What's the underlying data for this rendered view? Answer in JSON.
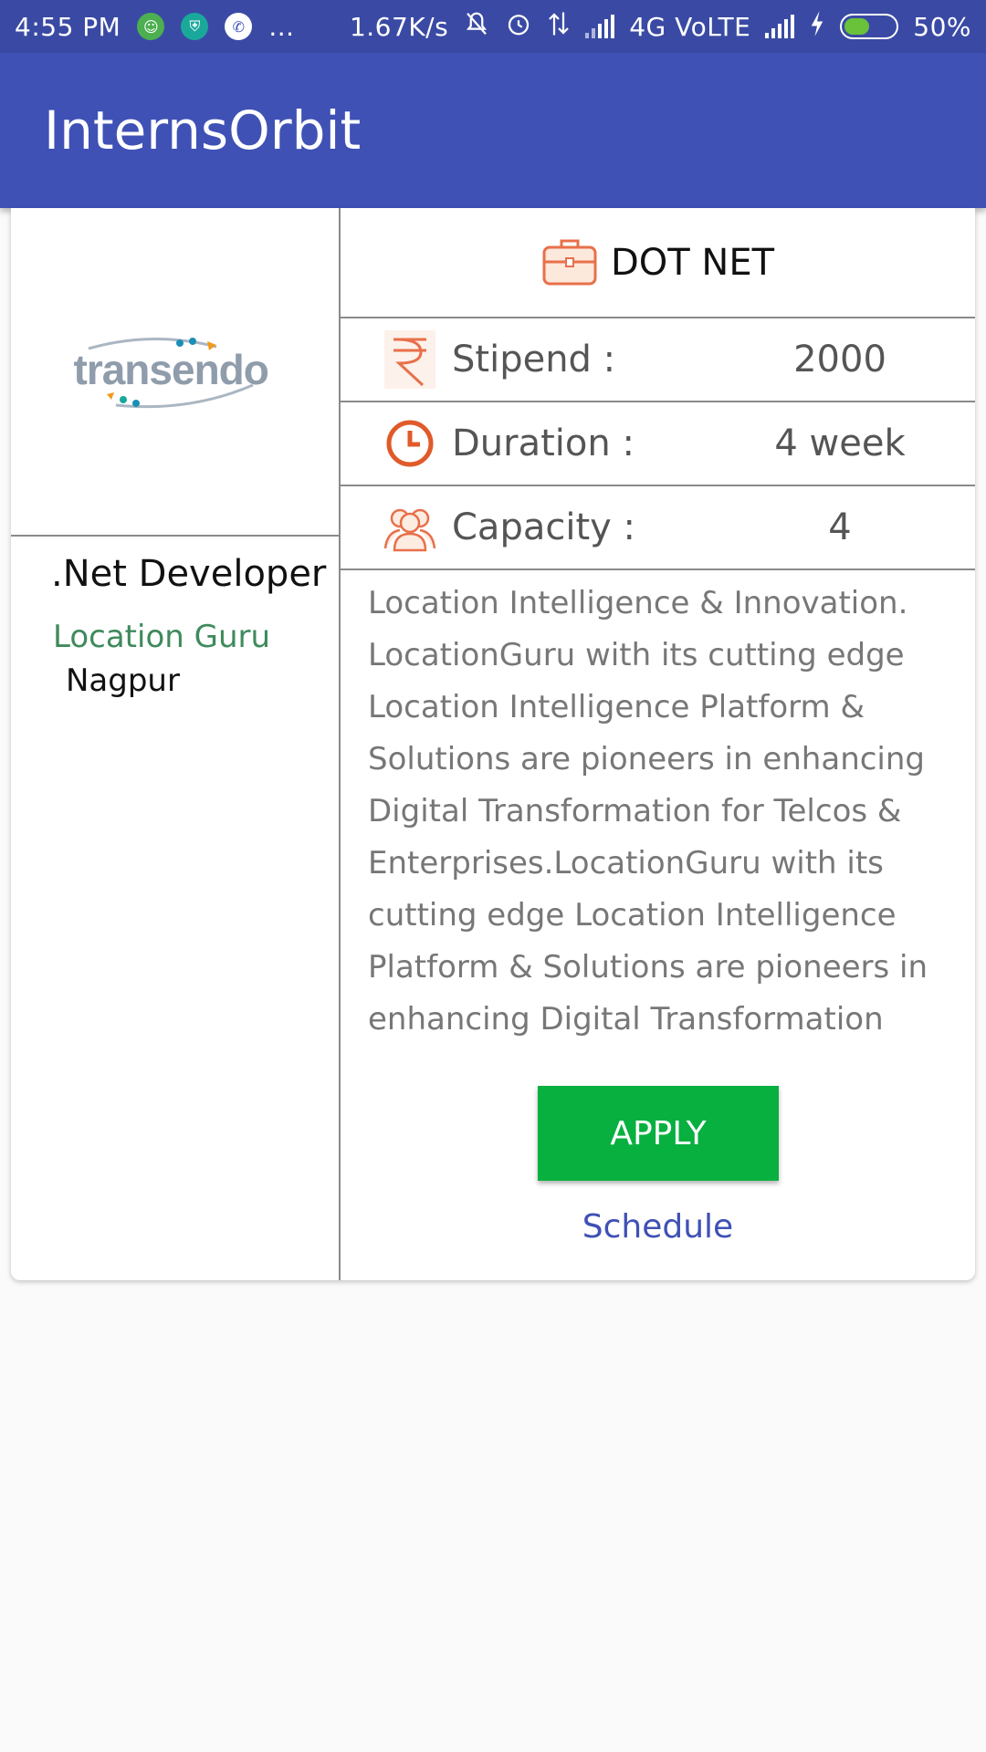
{
  "status_bar": {
    "time": "4:55 PM",
    "more": "...",
    "speed": "1.67K/s",
    "network": "4G VoLTE",
    "battery": "50%",
    "battery_level": 0.5
  },
  "app_bar": {
    "title": "InternsOrbit"
  },
  "card": {
    "logo": {
      "company_logo_text": "transendo"
    },
    "job_title": ".Net Developer",
    "company": "Location Guru",
    "city": "Nagpur",
    "header": {
      "icon": "briefcase-icon",
      "title": "DOT NET"
    },
    "stipend": {
      "icon": "rupee-icon",
      "label": "Stipend :",
      "value": "2000"
    },
    "duration": {
      "icon": "clock-icon",
      "label": "Duration :",
      "value": "4 week"
    },
    "capacity": {
      "icon": "people-icon",
      "label": "Capacity :",
      "value": "4"
    },
    "description": "Location Intelligence & Innovation. LocationGuru with its cutting edge Location Intelligence Platform & Solutions are pioneers in enhancing Digital Transformation for Telcos & Enterprises.LocationGuru with its cutting edge Location Intelligence Platform & Solutions are pioneers in enhancing Digital Transformation",
    "apply_label": "APPLY",
    "schedule_label": "Schedule"
  },
  "colors": {
    "status_bar": "#3a4aa4",
    "app_bar": "#3f51b5",
    "apply": "#08b03f",
    "icon_orange": "#e8704a",
    "company": "#3f8a5c"
  }
}
